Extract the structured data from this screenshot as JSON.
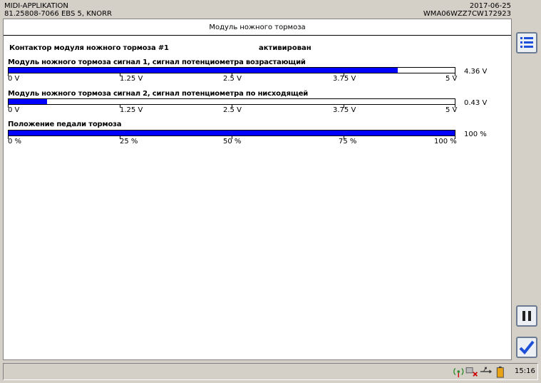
{
  "header": {
    "app_name": "MIDI-APPLIKATION",
    "module": "81.25808-7066  EBS 5, KNORR",
    "date": "2017-06-25",
    "vin": "WMA06WZZ7CW172923"
  },
  "panel": {
    "title": "Модуль ножного тормоза"
  },
  "contactor": {
    "label": "Контактор модуля ножного тормоза #1",
    "status": "активирован"
  },
  "gauges": [
    {
      "label": "Модуль ножного тормоза сигнал 1, сигнал потенциометра возрастающий",
      "value": "4.36 V",
      "level": 0.872,
      "ticks": [
        "0 V",
        "1.25 V",
        "2.5 V",
        "3.75 V",
        "5 V"
      ]
    },
    {
      "label": "Модуль ножного тормоза сигнал 2, сигнал потенциометра по нисходящей",
      "value": "0.43 V",
      "level": 0.086,
      "ticks": [
        "0 V",
        "1.25 V",
        "2.5 V",
        "3.75 V",
        "5 V"
      ]
    },
    {
      "label": "Положение педали тормоза",
      "value": "100 %",
      "level": 1.0,
      "ticks": [
        "0 %",
        "25 %",
        "50 %",
        "75 %",
        "100 %"
      ]
    }
  ],
  "sidebar": {
    "menu_icon": "list-icon",
    "pause_icon": "pause-icon",
    "confirm_icon": "checkmark-icon"
  },
  "statusbar": {
    "icons": [
      "wireless-signal-icon",
      "network-disconnected-icon",
      "usb-icon",
      "battery-icon"
    ],
    "time": "15:16"
  },
  "colors": {
    "bar_fill": "#0000ff",
    "accent_check": "#1d4fd8",
    "window_bg": "#d4d0c8"
  }
}
